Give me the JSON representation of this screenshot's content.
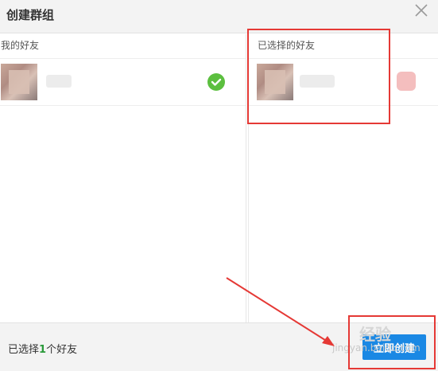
{
  "dialog": {
    "title": "创建群组",
    "close_icon": "close-icon"
  },
  "friends_panel": {
    "title": "我的好友",
    "items": [
      {
        "avatar": "blurred-avatar",
        "name": "",
        "selected": true,
        "check_icon": "checkmark-icon",
        "check_color": "#5cbf3f"
      }
    ]
  },
  "selected_panel": {
    "title": "已选择的好友",
    "items": [
      {
        "avatar": "blurred-avatar",
        "name": "",
        "remove_icon": "remove-icon"
      }
    ]
  },
  "footer": {
    "prefix": "已选择",
    "count": "1",
    "suffix": "个好友",
    "create_button": "立即创建"
  },
  "watermark": {
    "logo_text": "经验",
    "url": "jingyan.baidu.com"
  },
  "colors": {
    "accent_blue": "#1a88e4",
    "annotation_red": "#e53935",
    "count_green": "#2a9a3a"
  }
}
